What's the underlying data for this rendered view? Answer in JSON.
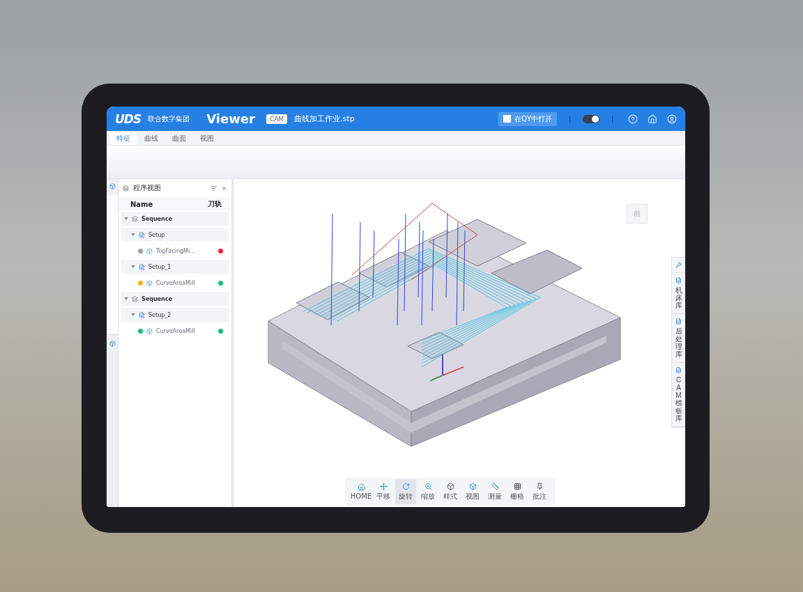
{
  "header": {
    "logo": "UDS",
    "company": "联合数字集团",
    "app_title": "Viewer",
    "badge": "CAM",
    "file_name": "曲线加工作业.stp",
    "open_button": "在QY中打开",
    "toggle": {
      "on": true
    }
  },
  "tabs": [
    {
      "label": "特征",
      "selected": true
    },
    {
      "label": "曲线",
      "selected": false
    },
    {
      "label": "曲面",
      "selected": false
    },
    {
      "label": "视图",
      "selected": false
    }
  ],
  "panel": {
    "title": "程序视图",
    "columns": [
      "Name",
      "刀轨"
    ],
    "tree": [
      {
        "label": "Sequence",
        "kind": "sequence",
        "expanded": true,
        "children": [
          {
            "label": "Setup",
            "kind": "setup",
            "expanded": true,
            "children": [
              {
                "label": "TopFacingMi...",
                "kind": "operation",
                "state": {
                  "color": "#9e9e9e"
                },
                "check": {
                  "color": "#f5222d"
                }
              }
            ]
          },
          {
            "label": "Setup_1",
            "kind": "setup",
            "expanded": true,
            "children": [
              {
                "label": "CurveAreaMill",
                "kind": "operation",
                "state": {
                  "color": "#faad14"
                },
                "check": {
                  "color": "#19be6b"
                }
              }
            ]
          }
        ]
      },
      {
        "label": "Sequence",
        "kind": "sequence",
        "expanded": true,
        "children": [
          {
            "label": "Setup_2",
            "kind": "setup",
            "expanded": true,
            "children": [
              {
                "label": "CurveAreaMill",
                "kind": "operation",
                "state": {
                  "color": "#19be6b"
                },
                "check": {
                  "color": "#19be6b"
                }
              }
            ]
          }
        ]
      }
    ]
  },
  "nav_cube": {
    "face": "前"
  },
  "right_tabs": [
    "机床库",
    "后处理库",
    "CAM模板库"
  ],
  "toolbar": [
    {
      "label": "HOME",
      "kind": "home",
      "selected": false
    },
    {
      "label": "平移",
      "kind": "pan",
      "selected": false
    },
    {
      "label": "旋转",
      "kind": "rotate",
      "selected": true
    },
    {
      "label": "缩放",
      "kind": "zoom",
      "selected": false
    },
    {
      "label": "样式",
      "kind": "style",
      "selected": false
    },
    {
      "label": "视图",
      "kind": "view",
      "selected": false
    },
    {
      "label": "测量",
      "kind": "measure",
      "selected": false
    },
    {
      "label": "栅格",
      "kind": "grid",
      "selected": false
    },
    {
      "label": "批注",
      "kind": "pin",
      "selected": false
    }
  ]
}
